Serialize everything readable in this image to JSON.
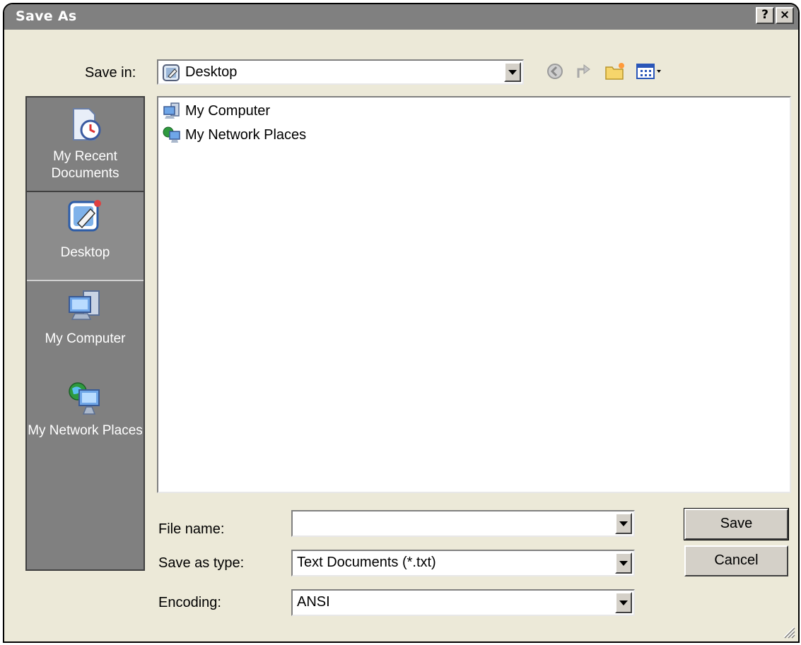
{
  "window": {
    "title": "Save As",
    "help_button": "?",
    "close_button": "×"
  },
  "save_in": {
    "label": "Save in:",
    "value": "Desktop"
  },
  "places_bar": {
    "items": [
      {
        "label": "My Recent Documents",
        "icon": "recent-documents-icon",
        "selected": false
      },
      {
        "label": "Desktop",
        "icon": "desktop-icon",
        "selected": true
      },
      {
        "label": "My Computer",
        "icon": "computer-icon",
        "selected": false
      },
      {
        "label": "My Network Places",
        "icon": "network-places-icon",
        "selected": false
      }
    ]
  },
  "file_list": {
    "items": [
      {
        "name": "My Computer",
        "icon": "computer-icon"
      },
      {
        "name": "My Network Places",
        "icon": "network-places-icon"
      }
    ]
  },
  "form": {
    "file_name": {
      "label": "File name:",
      "value": ""
    },
    "save_as_type": {
      "label": "Save as type:",
      "value": "Text Documents (*.txt)"
    },
    "encoding": {
      "label": "Encoding:",
      "value": "ANSI"
    }
  },
  "buttons": {
    "save": "Save",
    "cancel": "Cancel"
  }
}
